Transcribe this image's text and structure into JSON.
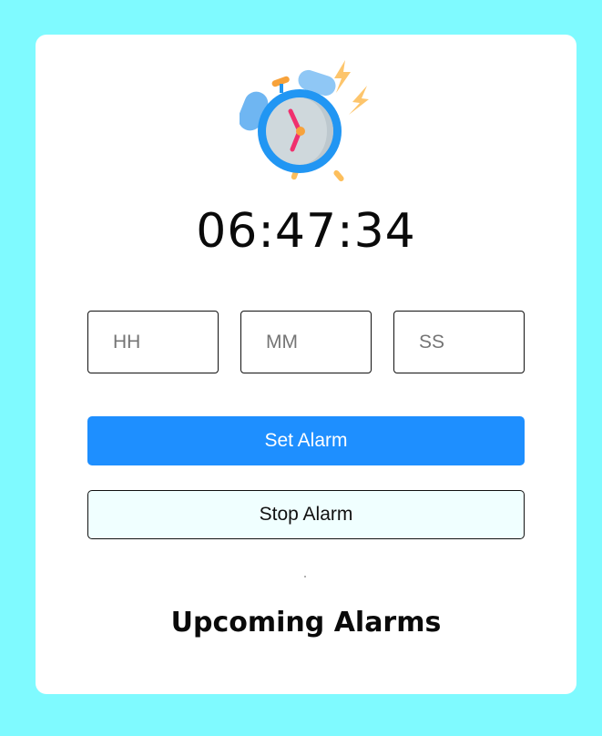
{
  "clock": {
    "time": "06:47:34",
    "illustration_icon": "alarm-clock-icon"
  },
  "inputs": {
    "hours_placeholder": "HH",
    "minutes_placeholder": "MM",
    "seconds_placeholder": "SS"
  },
  "buttons": {
    "set_label": "Set Alarm",
    "stop_label": "Stop Alarm"
  },
  "upcoming": {
    "title": "Upcoming Alarms"
  },
  "colors": {
    "background": "#7ffaff",
    "card": "#ffffff",
    "primary": "#1e8fff",
    "stop_button_bg": "#f0ffff"
  }
}
